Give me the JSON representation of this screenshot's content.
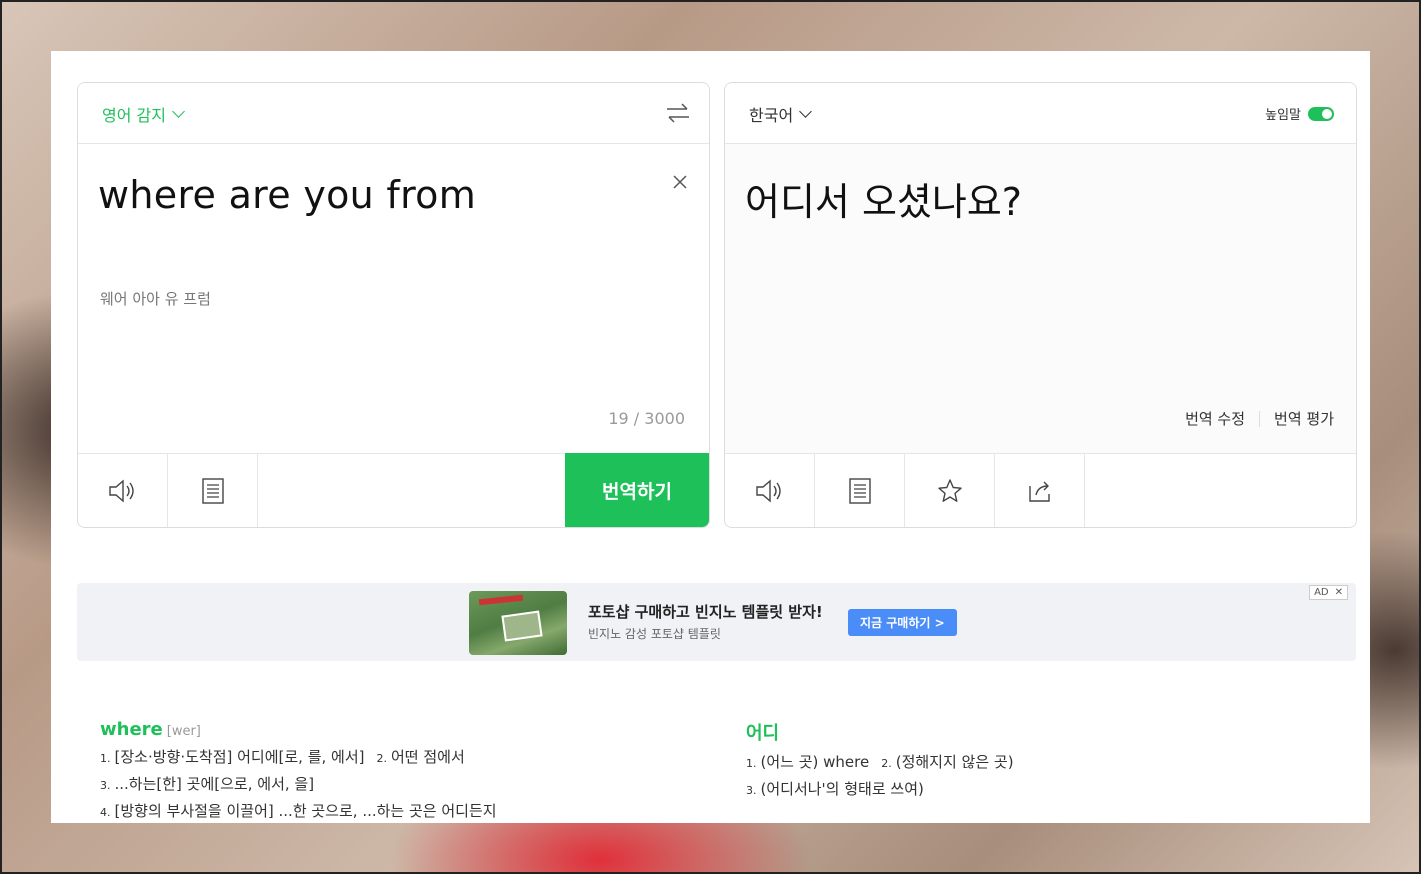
{
  "source": {
    "lang_label": "영어 감지",
    "text": "where are you from",
    "pronunciation": "웨어 아아 유 프럼",
    "counter": "19 / 3000",
    "translate_button": "번역하기"
  },
  "target": {
    "lang_label": "한국어",
    "honorific_label": "높임말",
    "honorific_on": true,
    "text": "어디서 오셨나요?",
    "edit_label": "번역 수정",
    "rate_label": "번역 평가"
  },
  "ad": {
    "title": "포토샵 구매하고 빈지노 템플릿 받자!",
    "subtitle": "빈지노 감성 포토샵 템플릿",
    "button": "지금 구매하기 >",
    "tag": "AD",
    "close": "✕"
  },
  "dictionary": {
    "left": {
      "word": "where",
      "phonetic": "[wer]",
      "lines": [
        [
          {
            "n": "1.",
            "t": "[장소·방향·도착점] 어디에[로, 를, 에서]"
          },
          {
            "n": "2.",
            "t": "어떤 점에서"
          }
        ],
        [
          {
            "n": "3.",
            "t": "...하는[한] 곳에[으로, 에서, 을]"
          }
        ],
        [
          {
            "n": "4.",
            "t": "[방향의 부사절을 이끌어] ...한 곳으로, ...하는 곳은 어디든지"
          }
        ]
      ]
    },
    "right": {
      "word": "어디",
      "lines": [
        [
          {
            "n": "1.",
            "t": "(어느 곳) where"
          },
          {
            "n": "2.",
            "t": "(정해지지 않은 곳)"
          }
        ],
        [
          {
            "n": "3.",
            "t": "(어디서나'의 형태로 쓰여)"
          }
        ]
      ]
    }
  },
  "colors": {
    "accent": "#1ec05a",
    "ad_button": "#4b8df8"
  }
}
